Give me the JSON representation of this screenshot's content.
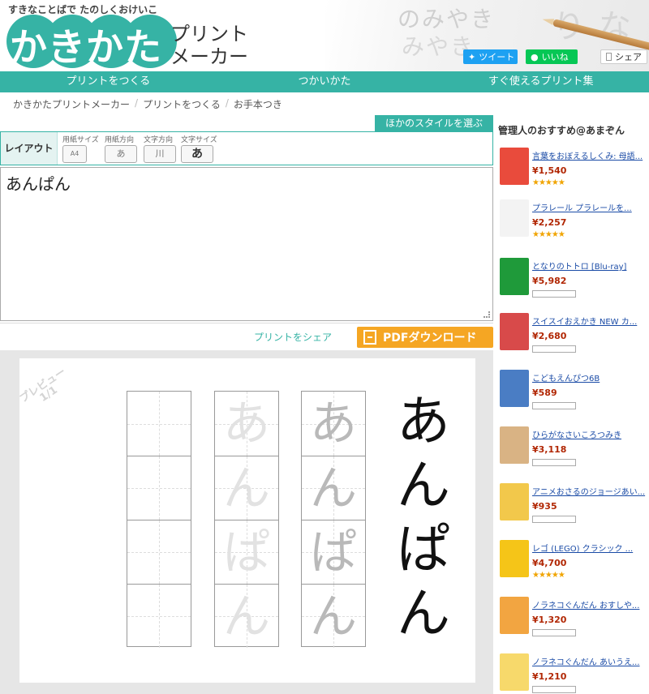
{
  "header": {
    "tagline": "すきなことばで たのしくおけいこ",
    "logo_main": "かきかた",
    "logo_sub_1": "プリント",
    "logo_sub_2": "メーカー",
    "tweet": "ツイート",
    "line": "いいね",
    "share": "シェア"
  },
  "nav": {
    "items": [
      "プリントをつくる",
      "つかいかた",
      "すぐ使えるプリント集"
    ]
  },
  "breadcrumb": [
    "かきかたプリントメーカー",
    "プリントをつくる",
    "お手本つき"
  ],
  "layout": {
    "style_tab": "ほかのスタイルを選ぶ",
    "label": "レイアウト",
    "options": [
      {
        "label": "用紙サイズ",
        "value": "A4"
      },
      {
        "label": "用紙方向",
        "value": "あ"
      },
      {
        "label": "文字方向",
        "value": "川"
      },
      {
        "label": "文字サイズ",
        "value": "あ"
      }
    ]
  },
  "editor": {
    "text": "あんぱん"
  },
  "actions": {
    "share_print": "プリントをシェア",
    "pdf": "PDFダウンロード"
  },
  "preview": {
    "watermark_1": "プレビュー",
    "watermark_2": "1/1",
    "chars": [
      "あ",
      "ん",
      "ぱ",
      "ん"
    ]
  },
  "sidebar": {
    "title": "管理人のおすすめ@あまぞん",
    "products": [
      {
        "name": "言葉をおぼえるしくみ: 母語...",
        "price": "¥1,540",
        "rating": "★★★★★",
        "color": "#e94b3c"
      },
      {
        "name": "プラレール プラレールを...",
        "price": "¥2,257",
        "rating": "★★★★★",
        "color": "#f3f3f3"
      },
      {
        "name": "となりのトトロ [Blu-ray]",
        "price": "¥5,982",
        "rating": "",
        "color": "#1f9a3a"
      },
      {
        "name": "スイスイおえかき NEW カ...",
        "price": "¥2,680",
        "rating": "",
        "color": "#d84a4a"
      },
      {
        "name": "こどもえんぴつ6B",
        "price": "¥589",
        "rating": "",
        "color": "#4a7dc4"
      },
      {
        "name": "ひらがなさいころつみき",
        "price": "¥3,118",
        "rating": "",
        "color": "#d9b384"
      },
      {
        "name": "アニメおさるのジョージあい...",
        "price": "¥935",
        "rating": "",
        "color": "#f2c84b"
      },
      {
        "name": "レゴ (LEGO) クラシック ...",
        "price": "¥4,700",
        "rating": "★★★★★",
        "color": "#f5c518"
      },
      {
        "name": "ノラネコぐんだん おすしや...",
        "price": "¥1,320",
        "rating": "",
        "color": "#f2a541"
      },
      {
        "name": "ノラネコぐんだん あいうえ...",
        "price": "¥1,210",
        "rating": "",
        "color": "#f7d96b"
      }
    ]
  }
}
